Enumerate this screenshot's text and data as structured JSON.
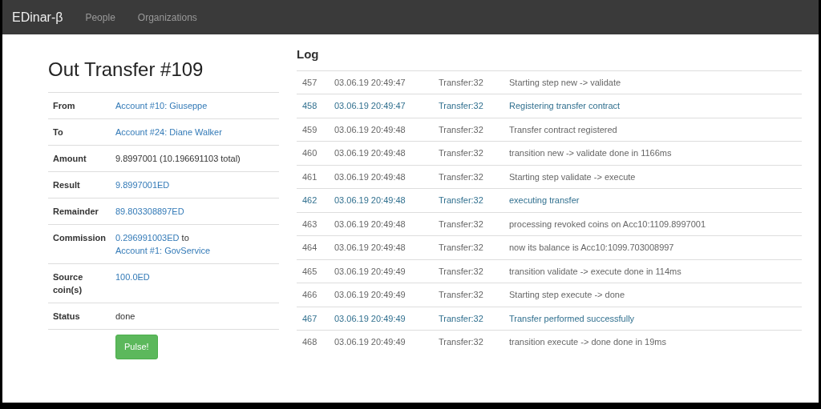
{
  "navbar": {
    "brand": "EDinar-β",
    "links": [
      "People",
      "Organizations"
    ]
  },
  "transfer": {
    "title": "Out Transfer #109",
    "fields": [
      {
        "label": "From",
        "parts": [
          {
            "text": "Account #10: Giuseppe",
            "link": true
          }
        ]
      },
      {
        "label": "To",
        "parts": [
          {
            "text": "Account #24: Diane Walker",
            "link": true
          }
        ]
      },
      {
        "label": "Amount",
        "parts": [
          {
            "text": "9.8997001 (10.196691103 total)",
            "link": false
          }
        ]
      },
      {
        "label": "Result",
        "parts": [
          {
            "text": "9.8997001ED",
            "link": true
          }
        ]
      },
      {
        "label": "Remainder",
        "parts": [
          {
            "text": "89.803308897ED",
            "link": true
          }
        ]
      },
      {
        "label": "Commission",
        "parts": [
          {
            "text": "0.296991003ED",
            "link": true
          },
          {
            "text": "to",
            "link": false
          },
          {
            "text": "Account #1: GovService",
            "link": true
          }
        ]
      },
      {
        "label": "Source coin(s)",
        "parts": [
          {
            "text": "100.0ED",
            "link": true
          }
        ]
      },
      {
        "label": "Status",
        "parts": [
          {
            "text": "done",
            "link": false
          }
        ]
      }
    ],
    "button": "Pulse!"
  },
  "log": {
    "title": "Log",
    "rows": [
      {
        "id": "457",
        "time": "03.06.19 20:49:47",
        "source": "Transfer:32",
        "message": "Starting step new -> validate",
        "kind": "plain"
      },
      {
        "id": "458",
        "time": "03.06.19 20:49:47",
        "source": "Transfer:32",
        "message": "Registering transfer contract",
        "kind": "info"
      },
      {
        "id": "459",
        "time": "03.06.19 20:49:48",
        "source": "Transfer:32",
        "message": "Transfer contract registered",
        "kind": "plain"
      },
      {
        "id": "460",
        "time": "03.06.19 20:49:48",
        "source": "Transfer:32",
        "message": "transition new -> validate done in 1166ms",
        "kind": "plain"
      },
      {
        "id": "461",
        "time": "03.06.19 20:49:48",
        "source": "Transfer:32",
        "message": "Starting step validate -> execute",
        "kind": "plain"
      },
      {
        "id": "462",
        "time": "03.06.19 20:49:48",
        "source": "Transfer:32",
        "message": "executing transfer",
        "kind": "info"
      },
      {
        "id": "463",
        "time": "03.06.19 20:49:48",
        "source": "Transfer:32",
        "message": "processing revoked coins on Acc10:1109.8997001",
        "kind": "plain"
      },
      {
        "id": "464",
        "time": "03.06.19 20:49:48",
        "source": "Transfer:32",
        "message": "now its balance is Acc10:1099.703008997",
        "kind": "plain"
      },
      {
        "id": "465",
        "time": "03.06.19 20:49:49",
        "source": "Transfer:32",
        "message": "transition validate -> execute done in 114ms",
        "kind": "plain"
      },
      {
        "id": "466",
        "time": "03.06.19 20:49:49",
        "source": "Transfer:32",
        "message": "Starting step execute -> done",
        "kind": "plain"
      },
      {
        "id": "467",
        "time": "03.06.19 20:49:49",
        "source": "Transfer:32",
        "message": "Transfer performed successfully",
        "kind": "info"
      },
      {
        "id": "468",
        "time": "03.06.19 20:49:49",
        "source": "Transfer:32",
        "message": "transition execute -> done done in 19ms",
        "kind": "plain"
      }
    ]
  }
}
